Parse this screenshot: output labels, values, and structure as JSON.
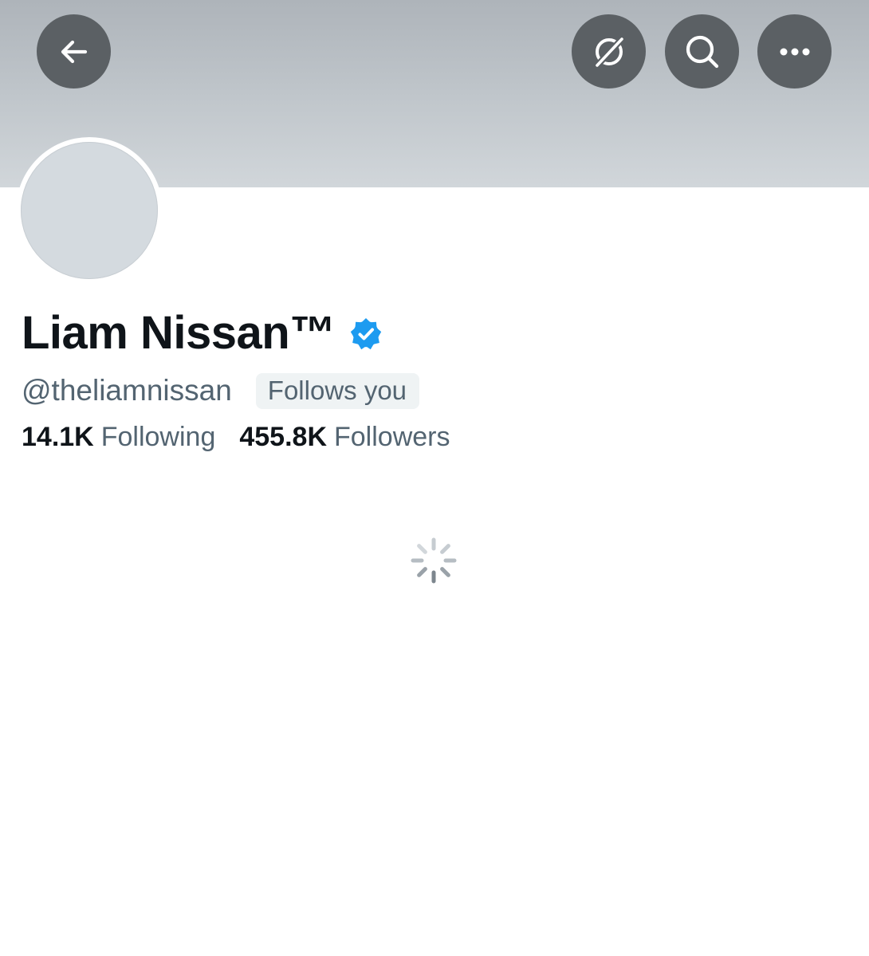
{
  "header": {
    "back_icon": "arrow-left-icon",
    "grok_icon": "grok-slash-circle-icon",
    "search_icon": "search-icon",
    "more_icon": "more-dots-icon",
    "button_color": "#5b6064"
  },
  "profile": {
    "display_name": "Liam Nissan™",
    "verified_icon": "verified-badge-icon",
    "verified_color": "#1d9bf0",
    "handle": "@theliamnissan",
    "follows_you": "Follows you",
    "following_count": "14.1K",
    "following_label": "Following",
    "followers_count": "455.8K",
    "followers_label": "Followers"
  },
  "status": {
    "loading_icon": "loading-spinner-icon"
  }
}
